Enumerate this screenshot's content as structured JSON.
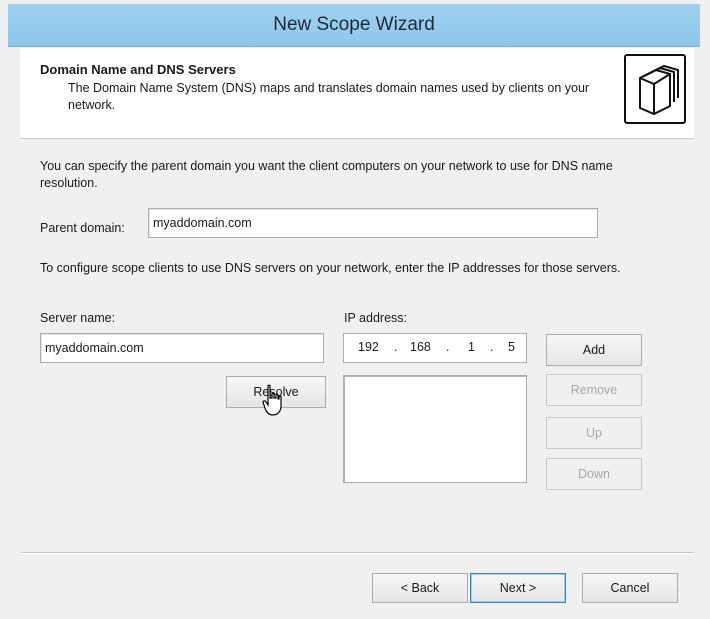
{
  "window": {
    "title": "New Scope Wizard"
  },
  "header": {
    "title": "Domain Name and DNS Servers",
    "description": "The Domain Name System (DNS) maps and translates domain names used by clients on your network.",
    "icon": "folders-icon"
  },
  "intro_text": "You can specify the parent domain you want the client computers on your network to use for DNS name resolution.",
  "parent_domain": {
    "label": "Parent domain:",
    "value": "myaddomain.com"
  },
  "servers_text": "To configure scope clients to use DNS servers on your network, enter the IP addresses for those servers.",
  "server_name": {
    "label": "Server name:",
    "value": "myaddomain.com"
  },
  "ip_address": {
    "label": "IP address:",
    "octets": [
      "192",
      "168",
      "1",
      "5"
    ]
  },
  "buttons": {
    "resolve": "Resolve",
    "add": "Add",
    "remove": "Remove",
    "up": "Up",
    "down": "Down",
    "back": "< Back",
    "next": "Next >",
    "cancel": "Cancel"
  },
  "ip_list": []
}
